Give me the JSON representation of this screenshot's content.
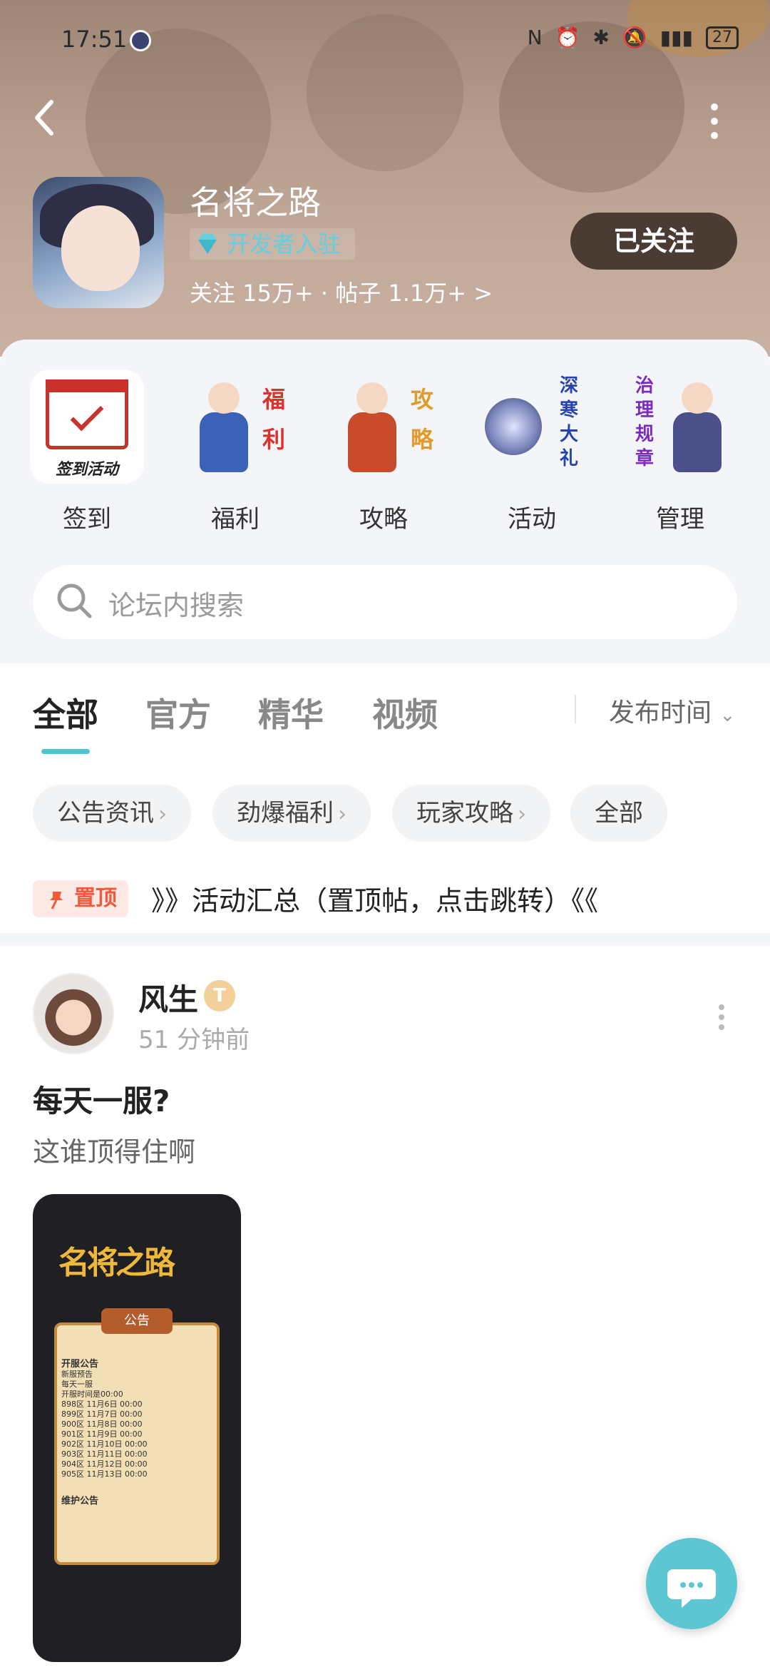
{
  "status_bar": {
    "time": "17:51",
    "battery": "27"
  },
  "header": {
    "forum_name": "名将之路",
    "dev_badge": "开发者入驻",
    "stats": "关注 15万+ · 帖子 1.1万+ >",
    "follow_label": "已关注"
  },
  "quick_entries": [
    {
      "label": "签到",
      "caption": "签到活动"
    },
    {
      "label": "福利",
      "vertical": "福利"
    },
    {
      "label": "攻略",
      "vertical": "攻略"
    },
    {
      "label": "活动",
      "vertical": "深寒大礼"
    },
    {
      "label": "管理",
      "vertical": "治理规章"
    }
  ],
  "search": {
    "placeholder": "论坛内搜索"
  },
  "tabs": [
    {
      "label": "全部",
      "active": true
    },
    {
      "label": "官方"
    },
    {
      "label": "精华"
    },
    {
      "label": "视频"
    }
  ],
  "sort": {
    "label": "发布时间"
  },
  "chips": [
    "公告资讯",
    "劲爆福利",
    "玩家攻略",
    "全部"
  ],
  "pinned": {
    "badge": "置顶",
    "text": "》》活动汇总（置顶帖，点击跳转）《《"
  },
  "post": {
    "author": "风生",
    "level": "T",
    "time": "51 分钟前",
    "title": "每天一服?",
    "body": "这谁顶得住啊",
    "image": {
      "logo": "名将之路",
      "panel_title": "公告",
      "lines": [
        "开服公告",
        "新服预告",
        "每天一服",
        "开服时间是00:00",
        "898区 11月6日 00:00",
        "899区 11月7日 00:00",
        "900区 11月8日 00:00",
        "901区 11月9日 00:00",
        "902区 11月10日 00:00",
        "903区 11月11日 00:00",
        "904区 11月12日 00:00",
        "905区 11月13日 00:00",
        "维护公告"
      ]
    }
  },
  "colors": {
    "accent": "#4fc3cf",
    "fab": "#5cc7d2",
    "follow_bg": "#4a3b33",
    "pin": "#f05a3a"
  }
}
